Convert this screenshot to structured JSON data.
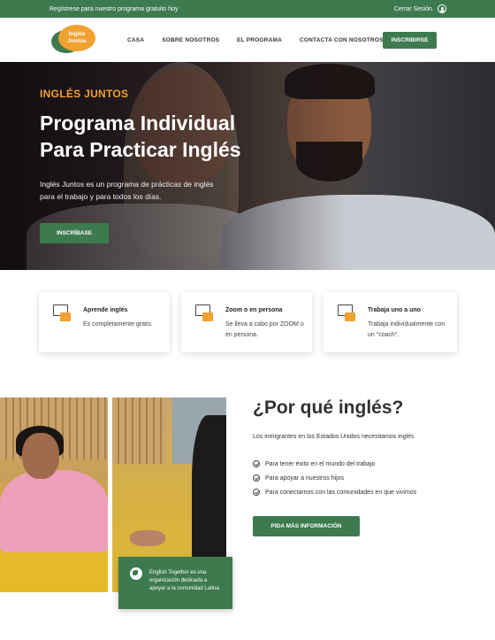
{
  "topbar": {
    "promo": "Regístrese para nuestro programa gratuito hoy",
    "logout": "Cerrar Sesión"
  },
  "logo": {
    "line1": "Inglés",
    "line2": "Juntos"
  },
  "nav": {
    "items": [
      "CASA",
      "SOBRE NOSOTROS",
      "EL PROGRAMA",
      "CONTACTA CON NOSOTROS"
    ],
    "cta": "INSCRIBIRSE"
  },
  "hero": {
    "brand": "INGLÉS JUNTOS",
    "title": "Programa Individual Para Practicar Inglés",
    "description": "Inglés Juntos es un programa de prácticas de inglés para el trabajo y para todos los días.",
    "button": "INSCRÍBASE"
  },
  "features": [
    {
      "title": "Aprende inglés",
      "text": "Es completamente gratis.",
      "icon": "certificate-icon"
    },
    {
      "title": "Zoom o en persona",
      "text": "Se lleva a cabo por ZOOM o en persona.",
      "icon": "video-call-icon"
    },
    {
      "title": "Trabaja uno a uno",
      "text": "Trabaja individualmente con un \"coach\".",
      "icon": "one-on-one-icon"
    }
  ],
  "info_card": {
    "text": "English Together es una organización dedicada a apoyar a la comunidad Latina."
  },
  "why": {
    "title": "¿Por qué inglés?",
    "subtitle": "Los inmigrantes en los Estados Unidos necesitamos inglés",
    "bullets": [
      "Para tener éxito en el mundo del trabajo",
      "Para apoyar a nuestros hijos",
      "Para conectarnos con las comunidades en que vivimos"
    ],
    "button": "PIDA MÁS INFORMACIÓN"
  },
  "colors": {
    "primary": "#3d7a4e",
    "accent": "#f0a130"
  }
}
